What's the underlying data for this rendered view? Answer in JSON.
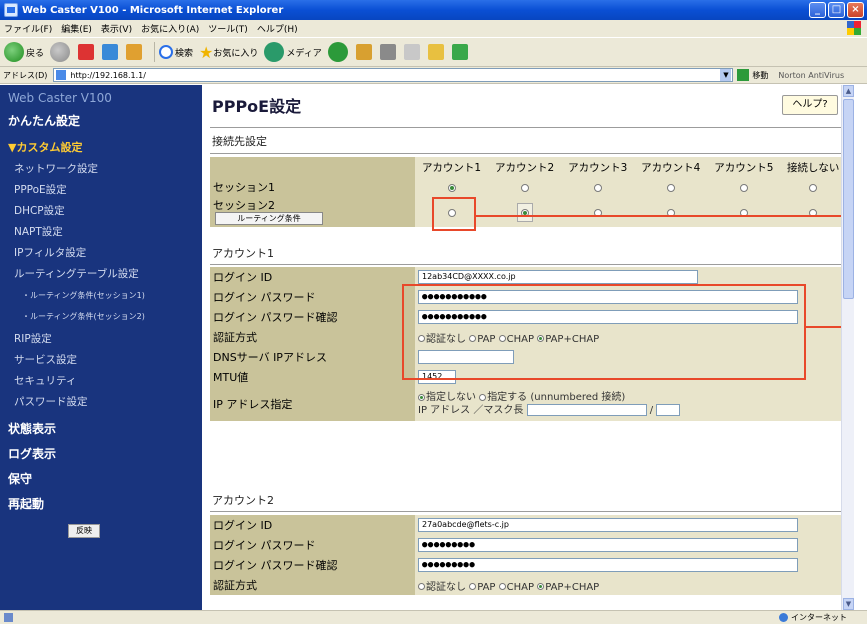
{
  "window": {
    "title": "Web Caster V100 - Microsoft Internet Explorer"
  },
  "menu": [
    "ファイル(F)",
    "編集(E)",
    "表示(V)",
    "お気に入り(A)",
    "ツール(T)",
    "ヘルプ(H)"
  ],
  "toolbar": {
    "back": "戻る",
    "search": "検索",
    "favorites": "お気に入り",
    "media": "メディア"
  },
  "address": {
    "label": "アドレス(D)",
    "url": "http://192.168.1.1/",
    "go": "移動",
    "norton": "Norton AntiVirus"
  },
  "sidebar": {
    "brand": "Web Caster V100",
    "easy": "かんたん設定",
    "custom": "▼カスタム設定",
    "items": [
      "ネットワーク設定",
      "PPPoE設定",
      "DHCP設定",
      "NAPT設定",
      "IPフィルタ設定",
      "ルーティングテーブル設定"
    ],
    "subitems": [
      "・ルーティング条件(セッション1)",
      "・ルーティング条件(セッション2)"
    ],
    "items2": [
      "RIP設定",
      "サービス設定",
      "セキュリティ",
      "パスワード設定"
    ],
    "status": "状態表示",
    "log": "ログ表示",
    "maint": "保守",
    "reboot": "再起動",
    "apply": "反映"
  },
  "page": {
    "title": "PPPoE設定",
    "help": "ヘルプ?",
    "conn_section": "接続先設定",
    "columns": [
      "アカウント1",
      "アカウント2",
      "アカウント3",
      "アカウント4",
      "アカウント5",
      "接続しない"
    ],
    "session1": "セッション1",
    "session2": "セッション2",
    "routing_btn": "ルーティング条件",
    "account1": {
      "heading": "アカウント1",
      "login_id_label": "ログイン ID",
      "login_id": "12ab34CD@XXXX.co.jp",
      "password_label": "ログイン パスワード",
      "password": "●●●●●●●●●●●",
      "password_confirm_label": "ログイン パスワード確認",
      "password_confirm": "●●●●●●●●●●●",
      "auth_label": "認証方式",
      "auth_options": [
        "認証なし",
        "PAP",
        "CHAP",
        "PAP+CHAP"
      ],
      "dns_label": "DNSサーバ IPアドレス",
      "mtu_label": "MTU値",
      "mtu": "1452",
      "ip_label": "IP アドレス指定",
      "ip_opt1": "指定しない",
      "ip_opt2": "指定する (unnumbered 接続)",
      "ip_sub": "IP アドレス ／マスク長",
      "slash": "/"
    },
    "account2": {
      "heading": "アカウント2",
      "login_id_label": "ログイン ID",
      "login_id": "27a0abcde@flets-c.jp",
      "password_label": "ログイン パスワード",
      "password": "●●●●●●●●●",
      "password_confirm_label": "ログイン パスワード確認",
      "password_confirm": "●●●●●●●●●",
      "auth_label": "認証方式",
      "auth_options": [
        "認証なし",
        "PAP",
        "CHAP",
        "PAP+CHAP"
      ]
    }
  },
  "status": {
    "zone": "インターネット"
  }
}
